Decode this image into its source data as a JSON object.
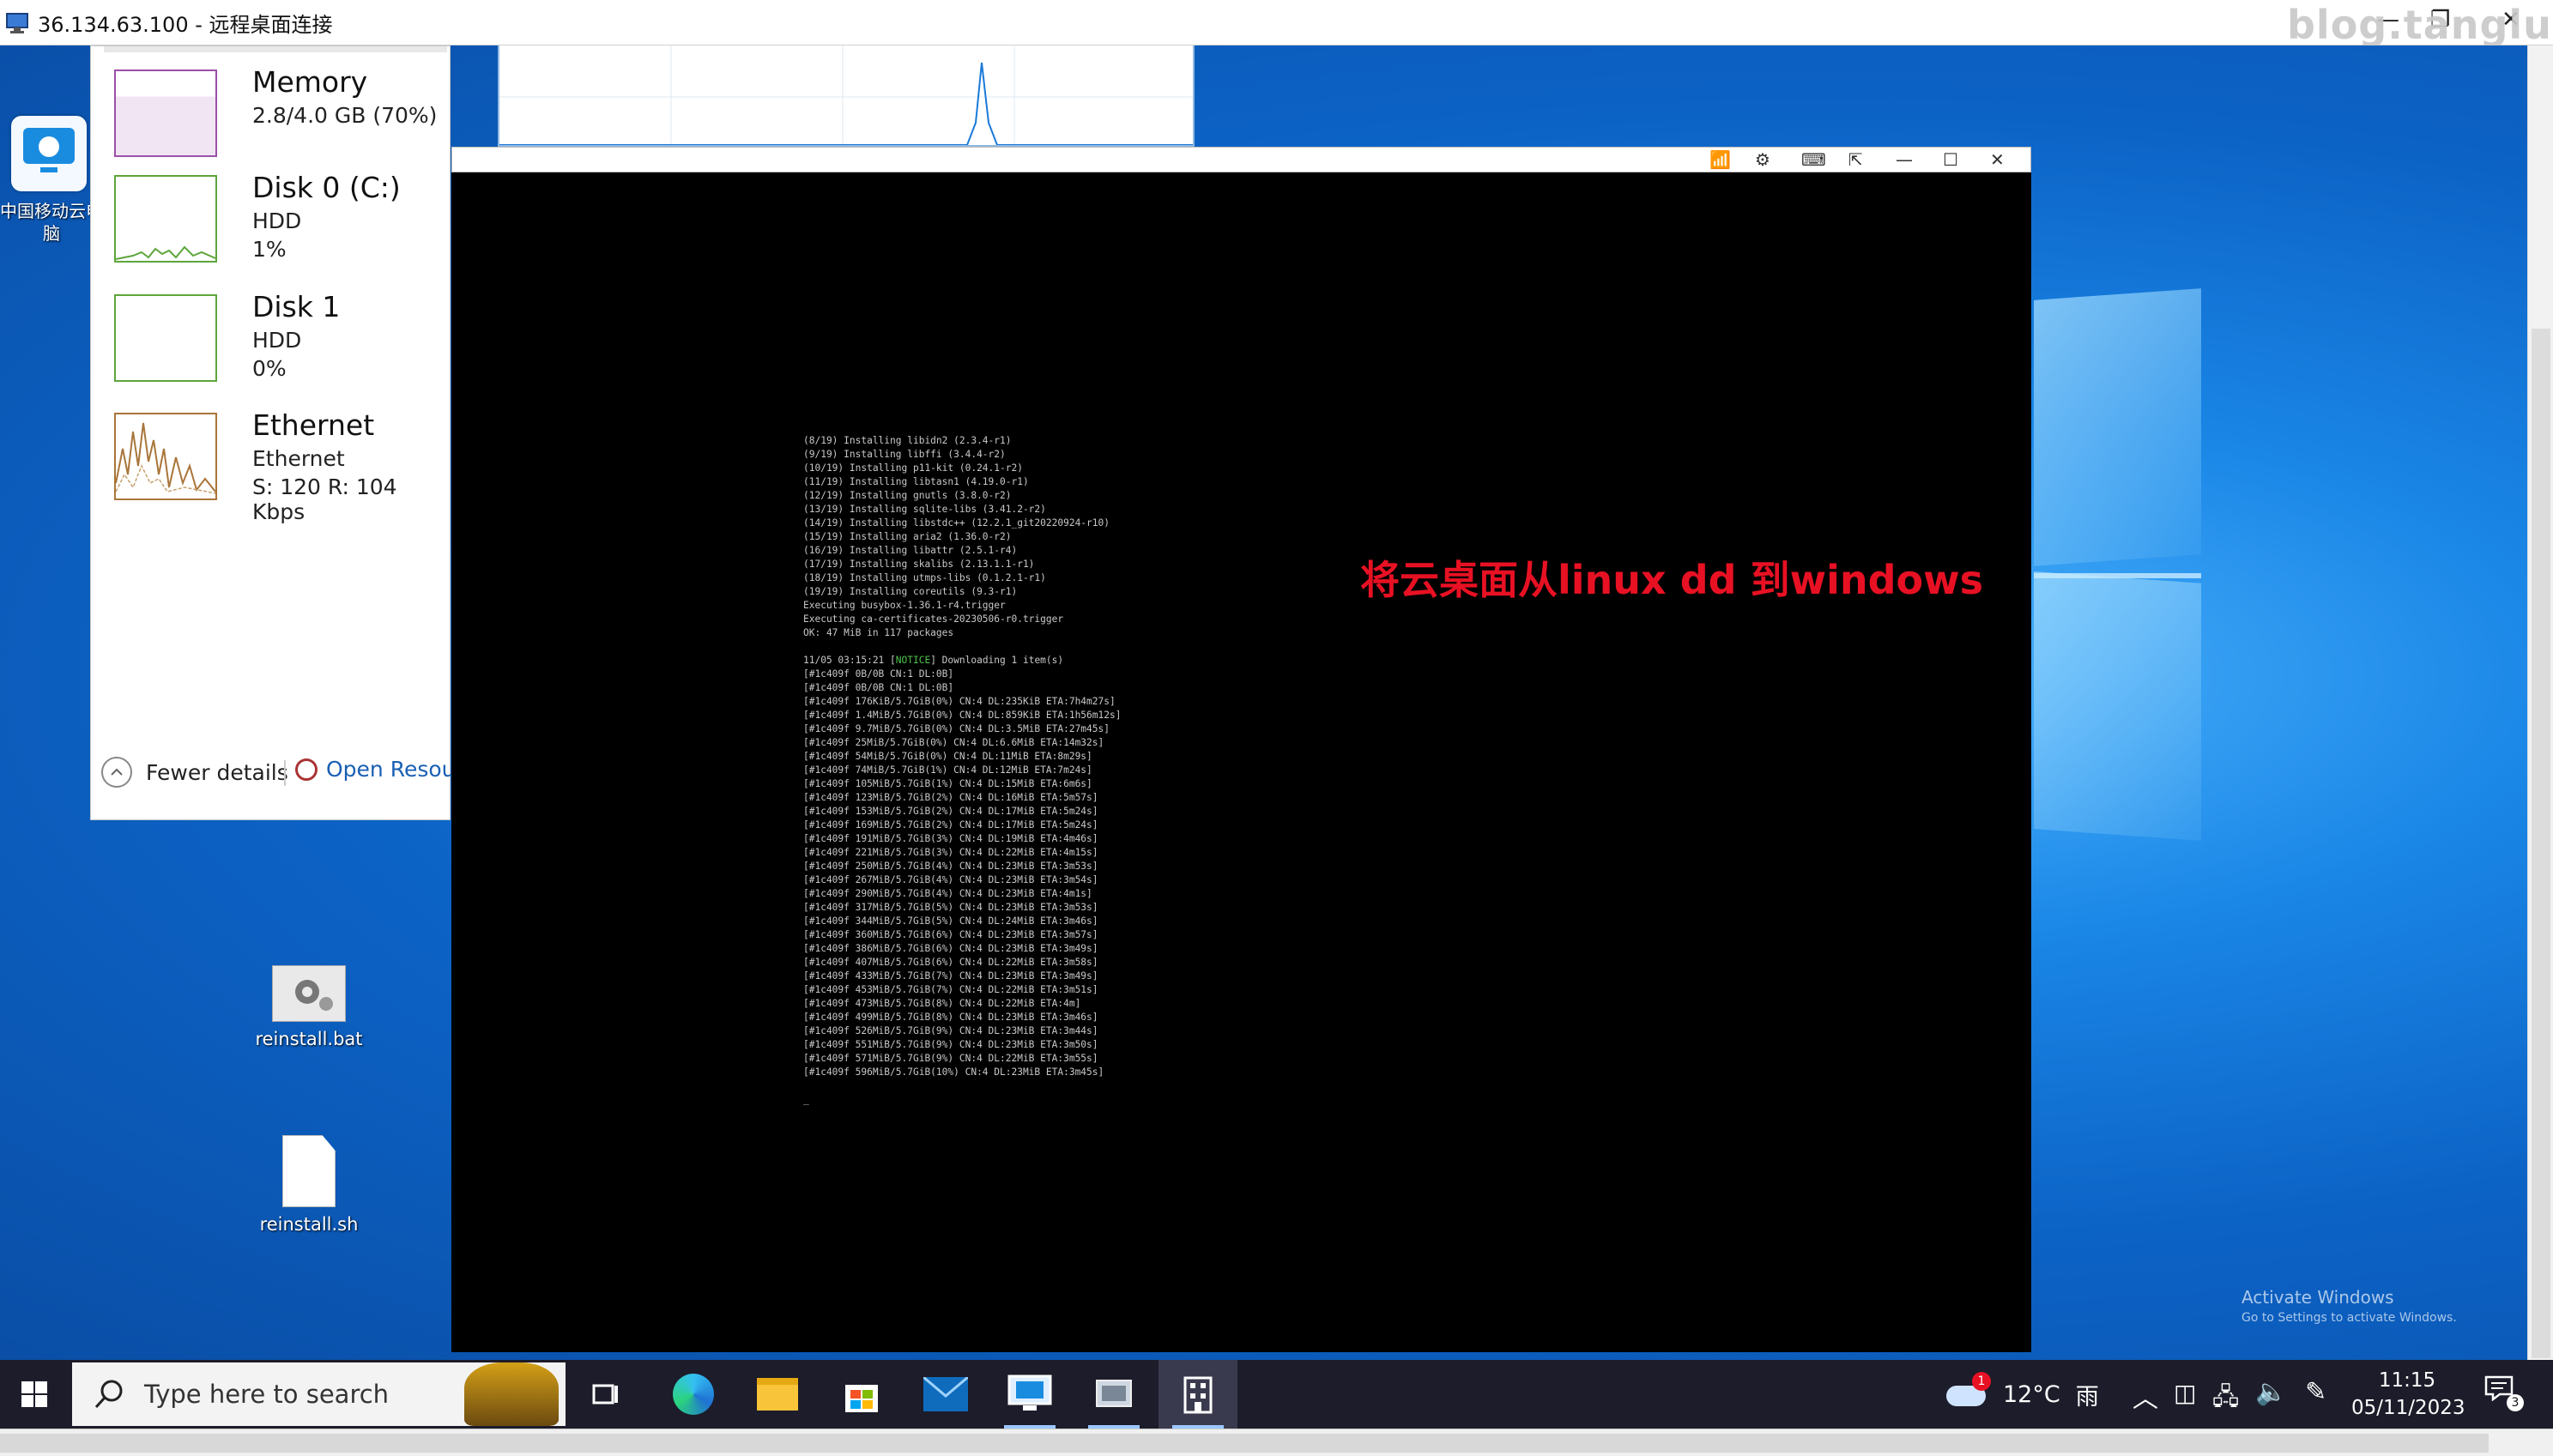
{
  "rdp_window": {
    "title": "36.134.63.100 - 远程桌面连接",
    "minimize": "—",
    "restore": "❐",
    "close": "✕"
  },
  "watermark": "blog.tanglu.me",
  "desktop_rdp_icon": {
    "label": "中国移动云电脑"
  },
  "task_manager": {
    "items": [
      {
        "name": "Memory",
        "line1": "2.8/4.0 GB (70%)",
        "line2": ""
      },
      {
        "name": "Disk 0 (C:)",
        "line1": "HDD",
        "line2": "1%"
      },
      {
        "name": "Disk 1",
        "line1": "HDD",
        "line2": "0%"
      },
      {
        "name": "Ethernet",
        "line1": "Ethernet",
        "line2": "S: 120  R: 104 Kbps"
      }
    ],
    "fewer_details": "Fewer details",
    "open_resource_monitor": "Open Resource Monitor"
  },
  "overlay_title": "将云桌面从linux dd 到windows",
  "console_lines": [
    "(8/19) Installing libidn2 (2.3.4-r1)",
    "(9/19) Installing libffi (3.4.4-r2)",
    "(10/19) Installing p11-kit (0.24.1-r2)",
    "(11/19) Installing libtasn1 (4.19.0-r1)",
    "(12/19) Installing gnutls (3.8.0-r2)",
    "(13/19) Installing sqlite-libs (3.41.2-r2)",
    "(14/19) Installing libstdc++ (12.2.1_git20220924-r10)",
    "(15/19) Installing aria2 (1.36.0-r2)",
    "(16/19) Installing libattr (2.5.1-r4)",
    "(17/19) Installing skalibs (2.13.1.1-r1)",
    "(18/19) Installing utmps-libs (0.1.2.1-r1)",
    "(19/19) Installing coreutils (9.3-r1)",
    "Executing busybox-1.36.1-r4.trigger",
    "Executing ca-certificates-20230506-r0.trigger",
    "OK: 47 MiB in 117 packages",
    "",
    "11/05 03:15:21 [NOTICE] Downloading 1 item(s)",
    "[#1c409f 0B/0B CN:1 DL:0B]",
    "[#1c409f 0B/0B CN:1 DL:0B]",
    "[#1c409f 176KiB/5.7GiB(0%) CN:4 DL:235KiB ETA:7h4m27s]",
    "[#1c409f 1.4MiB/5.7GiB(0%) CN:4 DL:859KiB ETA:1h56m12s]",
    "[#1c409f 9.7MiB/5.7GiB(0%) CN:4 DL:3.5MiB ETA:27m45s]",
    "[#1c409f 25MiB/5.7GiB(0%) CN:4 DL:6.6MiB ETA:14m32s]",
    "[#1c409f 54MiB/5.7GiB(0%) CN:4 DL:11MiB ETA:8m29s]",
    "[#1c409f 74MiB/5.7GiB(1%) CN:4 DL:12MiB ETA:7m24s]",
    "[#1c409f 105MiB/5.7GiB(1%) CN:4 DL:15MiB ETA:6m6s]",
    "[#1c409f 123MiB/5.7GiB(2%) CN:4 DL:16MiB ETA:5m57s]",
    "[#1c409f 153MiB/5.7GiB(2%) CN:4 DL:17MiB ETA:5m24s]",
    "[#1c409f 169MiB/5.7GiB(2%) CN:4 DL:17MiB ETA:5m24s]",
    "[#1c409f 191MiB/5.7GiB(3%) CN:4 DL:19MiB ETA:4m46s]",
    "[#1c409f 221MiB/5.7GiB(3%) CN:4 DL:22MiB ETA:4m15s]",
    "[#1c409f 250MiB/5.7GiB(4%) CN:4 DL:23MiB ETA:3m53s]",
    "[#1c409f 267MiB/5.7GiB(4%) CN:4 DL:23MiB ETA:3m54s]",
    "[#1c409f 290MiB/5.7GiB(4%) CN:4 DL:23MiB ETA:4m1s]",
    "[#1c409f 317MiB/5.7GiB(5%) CN:4 DL:23MiB ETA:3m53s]",
    "[#1c409f 344MiB/5.7GiB(5%) CN:4 DL:24MiB ETA:3m46s]",
    "[#1c409f 360MiB/5.7GiB(6%) CN:4 DL:23MiB ETA:3m57s]",
    "[#1c409f 386MiB/5.7GiB(6%) CN:4 DL:23MiB ETA:3m49s]",
    "[#1c409f 407MiB/5.7GiB(6%) CN:4 DL:22MiB ETA:3m58s]",
    "[#1c409f 433MiB/5.7GiB(7%) CN:4 DL:23MiB ETA:3m49s]",
    "[#1c409f 453MiB/5.7GiB(7%) CN:4 DL:22MiB ETA:3m51s]",
    "[#1c409f 473MiB/5.7GiB(8%) CN:4 DL:22MiB ETA:4m]",
    "[#1c409f 499MiB/5.7GiB(8%) CN:4 DL:23MiB ETA:3m46s]",
    "[#1c409f 526MiB/5.7GiB(9%) CN:4 DL:23MiB ETA:3m44s]",
    "[#1c409f 551MiB/5.7GiB(9%) CN:4 DL:23MiB ETA:3m50s]",
    "[#1c409f 571MiB/5.7GiB(9%) CN:4 DL:22MiB ETA:3m55s]",
    "[#1c409f 596MiB/5.7GiB(10%) CN:4 DL:23MiB ETA:3m45s]",
    "",
    "_"
  ],
  "desktop_icons": [
    {
      "label": "reinstall.bat",
      "icon": "gear-file-icon"
    },
    {
      "label": "reinstall.sh",
      "icon": "blank-file-icon"
    }
  ],
  "activate_windows": {
    "line1": "Activate Windows",
    "line2": "Go to Settings to activate Windows."
  },
  "taskbar": {
    "search_placeholder": "Type here to search",
    "weather_badge": "1",
    "weather_temp": "12°C",
    "weather_desc": "雨",
    "time": "11:15",
    "date": "05/11/2023",
    "notification_count": "3"
  },
  "colors": {
    "desktop_blue": "#0c63c6",
    "overlay_red": "#e81123",
    "taskbar": "#1c1c2a",
    "console_bg": "#000000"
  }
}
